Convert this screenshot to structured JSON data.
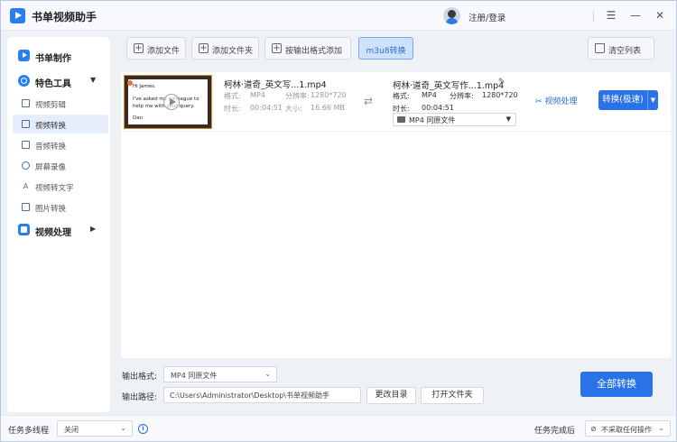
{
  "app": {
    "title": "书单视频助手",
    "login_label": "注册/登录"
  },
  "window_controls": {
    "menu": "☰",
    "minimize": "—",
    "close": "✕"
  },
  "sidebar": {
    "video_make": "书单制作",
    "special_tools": "特色工具",
    "tools": [
      {
        "label": "视频剪辑",
        "icon": "crop-icon"
      },
      {
        "label": "视频转换",
        "icon": "convert-icon",
        "active": true
      },
      {
        "label": "音频转换",
        "icon": "audio-icon"
      },
      {
        "label": "屏幕录像",
        "icon": "record-icon"
      },
      {
        "label": "视频转文字",
        "icon": "text-icon"
      },
      {
        "label": "图片转换",
        "icon": "image-icon"
      }
    ],
    "video_process": "视频处理"
  },
  "toolbar": {
    "add_file": "添加文件",
    "add_folder": "添加文件夹",
    "add_by_format": "按输出格式添加",
    "m3u8": "m3u8转换",
    "clear_list": "清空列表"
  },
  "file": {
    "thumb_lines": [
      "Hi James.",
      "I've asked my colleague to",
      "help me with your query.",
      "Dan"
    ],
    "source_name": "柯林·道奇_英文写...1.mp4",
    "format_label": "格式:",
    "format": "MP4",
    "resolution_label": "分辨率:",
    "resolution": "1280*720",
    "duration_label": "时长:",
    "duration": "00:04:51",
    "size_label": "大小:",
    "size": "16.66 MB",
    "target_name": "柯林·道奇_英文写作...1.mp4",
    "target_format": "MP4",
    "target_resolution": "1280*720",
    "target_duration": "00:04:51",
    "output_select": "MP4  同原文件",
    "video_process": "视频处理",
    "convert_button": "转换(极速)"
  },
  "bottom": {
    "output_format_label": "输出格式:",
    "output_format_value": "MP4  同原文件",
    "output_path_label": "输出路径:",
    "output_path_value": "C:\\Users\\Administrator\\Desktop\\书单视频助手",
    "change_dir": "更改目录",
    "open_folder": "打开文件夹",
    "convert_all": "全部转换"
  },
  "status": {
    "multithread_label": "任务多线程",
    "multithread_value": "关闭",
    "on_complete_label": "任务完成后",
    "on_complete_value": "不采取任何操作"
  },
  "colors": {
    "accent": "#2a72e8",
    "background": "#eef1f6",
    "active_nav": "#e6eefb"
  }
}
